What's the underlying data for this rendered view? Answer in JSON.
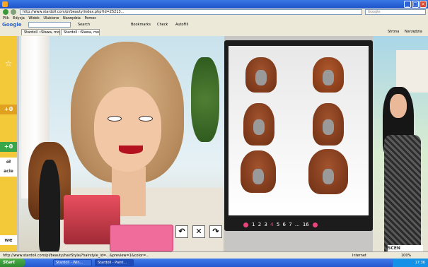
{
  "browser": {
    "url": "http://www.stardoll.com/pl/beauty/index.php?id=25213...",
    "search_placeholder": "Google",
    "menu": [
      "Plik",
      "Edycja",
      "Widok",
      "Ulubione",
      "Narzędzia",
      "Pomoc"
    ],
    "google_toolbar": {
      "logo": "Google",
      "buttons": [
        "Search",
        "Bookmarks",
        "Check",
        "AutoFill"
      ]
    },
    "tabs": [
      {
        "label": "Stardoll ::Sława, moda ...",
        "active": false
      },
      {
        "label": "Stardoll ::Sława, moda i przy...",
        "active": true
      }
    ],
    "tab_tools": [
      "Strona",
      "Narzędzia"
    ]
  },
  "left_panel": {
    "items": [
      "☆",
      "+0",
      "+0"
    ],
    "text_fragments": [
      "ół",
      "acie",
      "we"
    ]
  },
  "beauty_parlor": {
    "pager": {
      "pages": [
        "1",
        "2",
        "3",
        "4",
        "5",
        "6",
        "7",
        "...",
        "16"
      ]
    },
    "controls": [
      "↶",
      "✕",
      "↷"
    ]
  },
  "right_panel": {
    "sign": "SCEN"
  },
  "status": {
    "text": "http://www.stardoll.com/pl/beauty/hairStyle/?hairstyle_id=...&preview=1&color=...",
    "zone": "Internet",
    "zoom": "100%"
  },
  "taskbar": {
    "start": "Start",
    "tasks": [
      {
        "label": "Stardoll - Win...",
        "active": false
      },
      {
        "label": "Stardoll - Paint...",
        "active": false
      }
    ],
    "clock": "17:36"
  },
  "colors": {
    "titlebar": "#1c53c8",
    "left_panel": "#f3c93a",
    "pager_arrow": "#e8457a",
    "start_button": "#2f8a2f"
  }
}
